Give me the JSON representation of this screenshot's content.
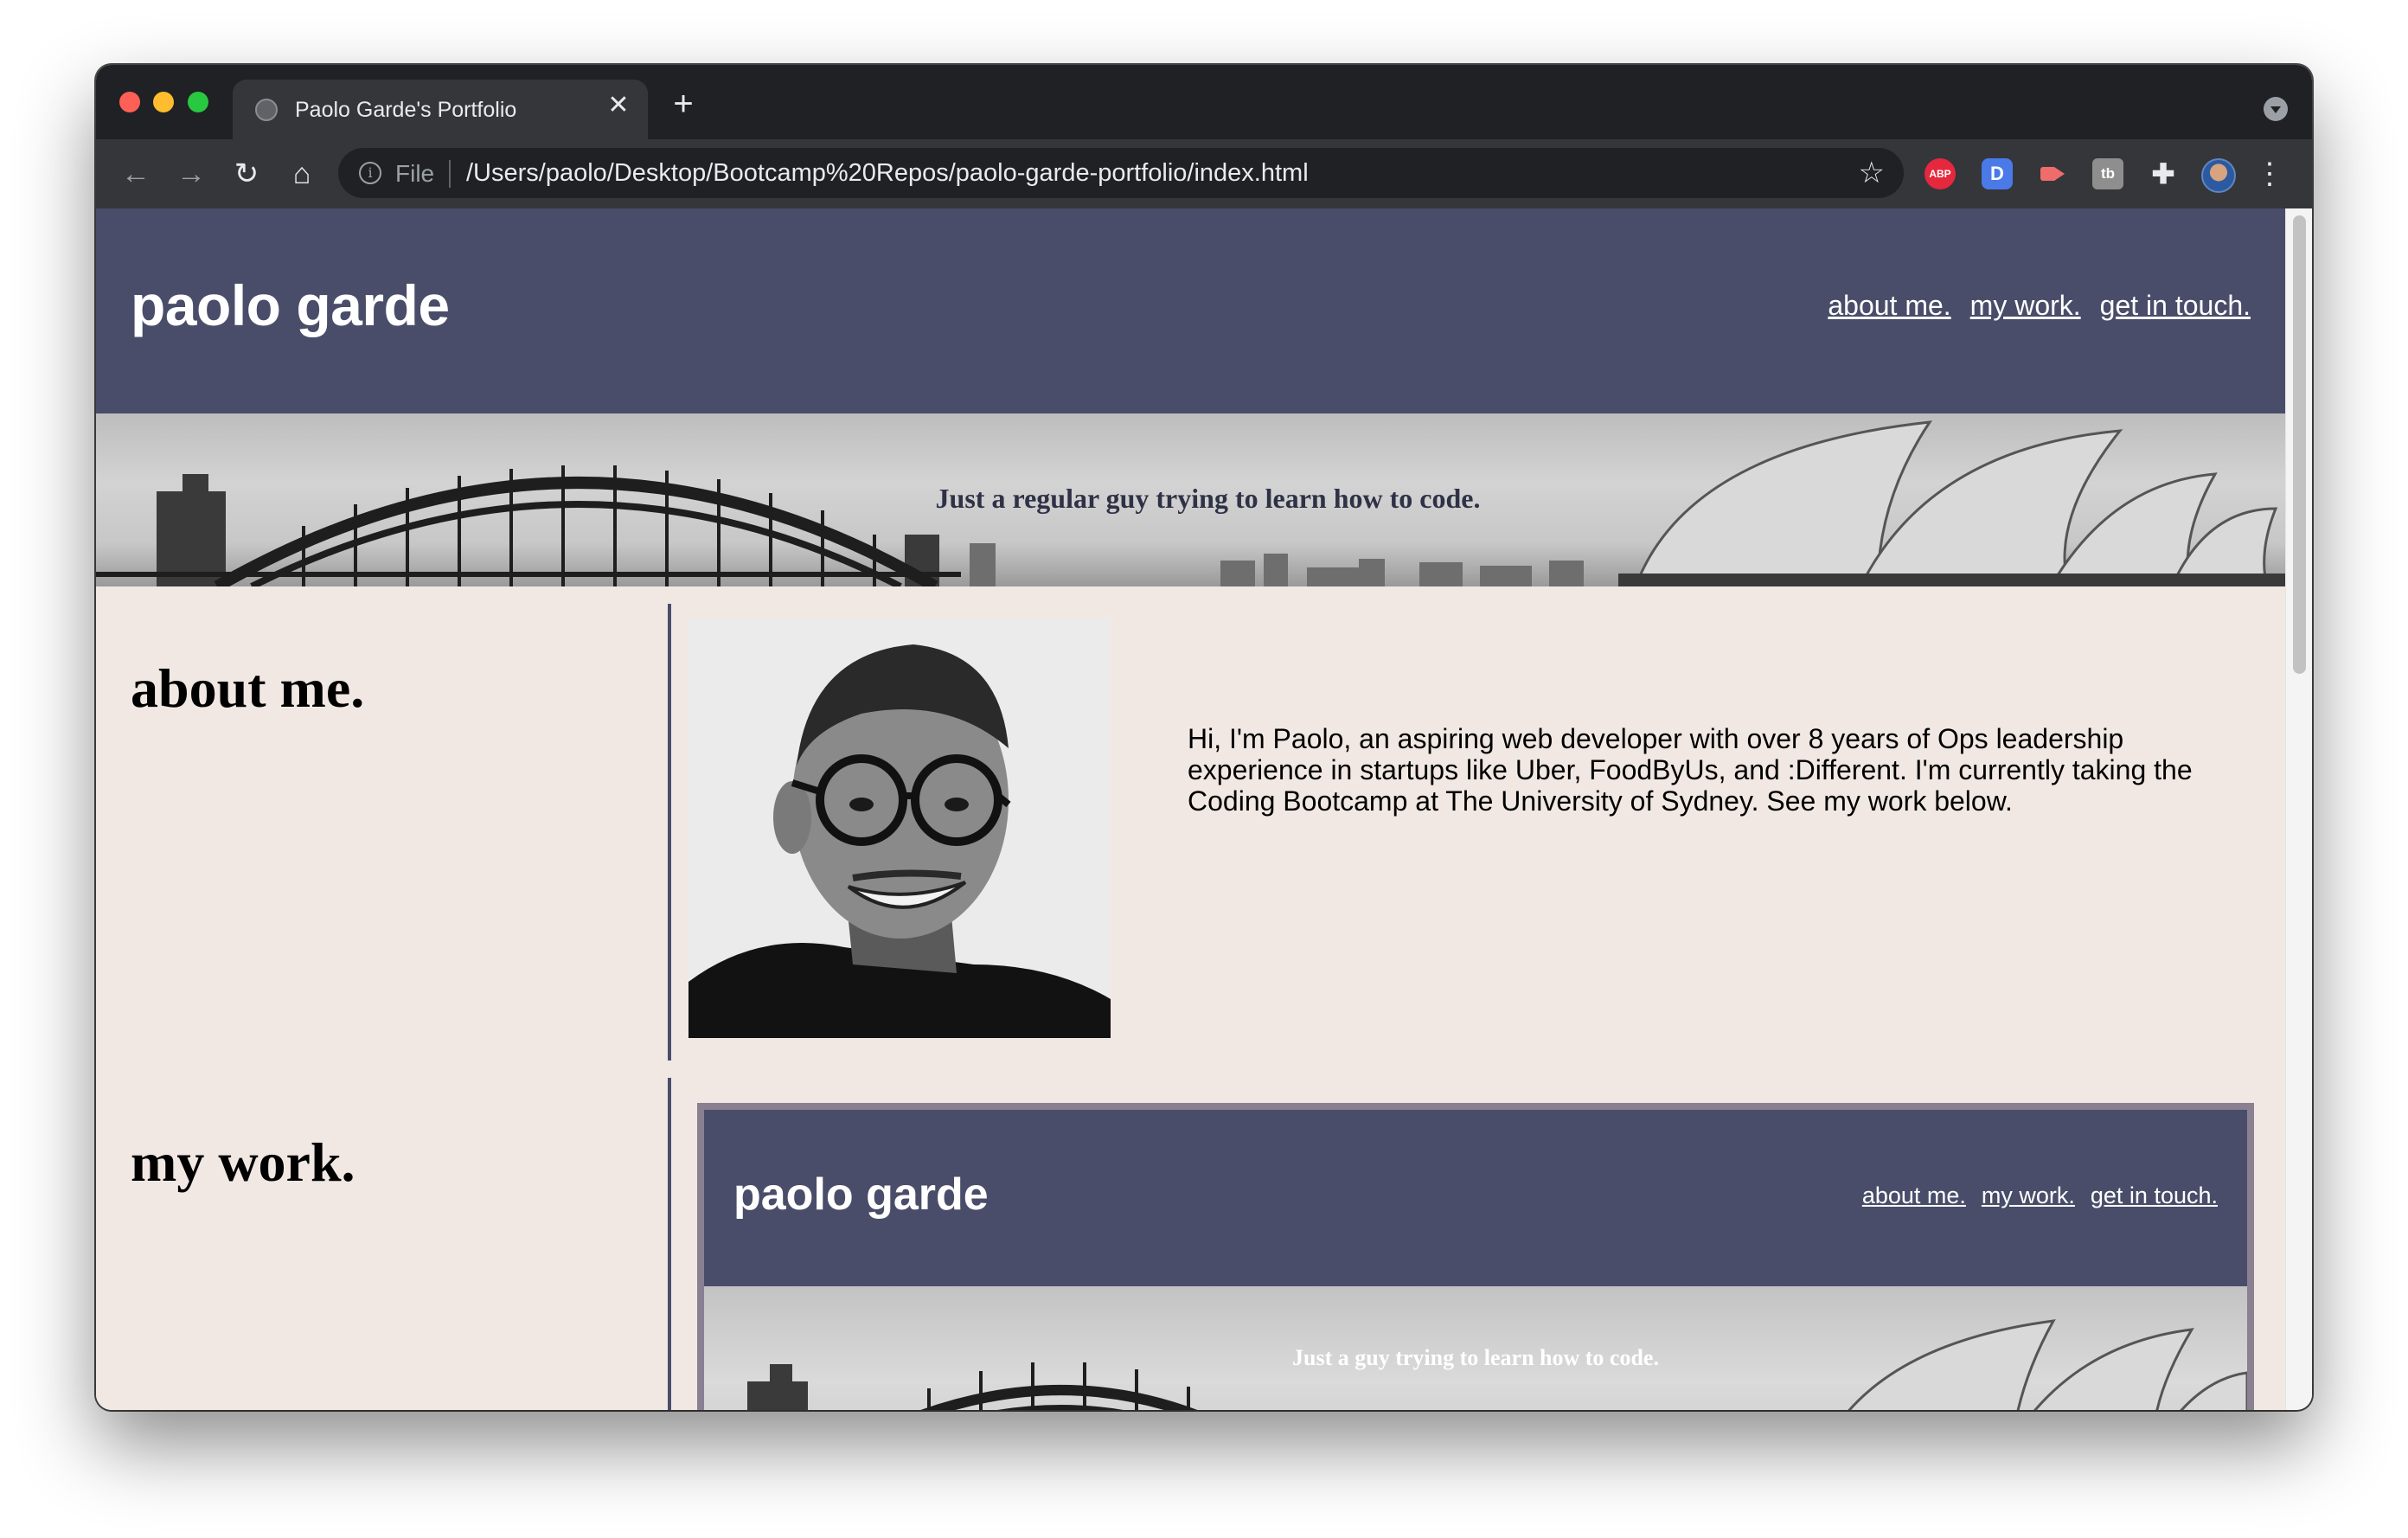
{
  "browser": {
    "tab_title": "Paolo Garde's Portfolio",
    "tab_close": "✕",
    "new_tab": "+",
    "url_scheme_label": "File",
    "url": "/Users/paolo/Desktop/Bootcamp%20Repos/paolo-garde-portfolio/index.html",
    "extensions": [
      {
        "name": "adblock-plus",
        "label": "ABP"
      },
      {
        "name": "d-extension",
        "label": "D"
      },
      {
        "name": "tb-extension",
        "label": "tb"
      }
    ]
  },
  "site": {
    "brand": "paolo garde",
    "nav": [
      "about me.",
      "my work.",
      "get in touch."
    ],
    "tagline": "Just a regular guy trying to learn how to code.",
    "about_heading": "about me.",
    "bio": "Hi, I'm Paolo, an aspiring web developer with over 8 years of Ops leadership experience in startups like Uber, FoodByUs, and :Different. I'm currently taking the Coding Bootcamp at The University of Sydney. See my work below.",
    "work_heading": "my work."
  },
  "preview": {
    "brand": "paolo garde",
    "nav": [
      "about me.",
      "my work.",
      "get in touch."
    ],
    "tagline": "Just a guy trying to learn how to code."
  },
  "colors": {
    "header_bg": "#494d69",
    "page_bg": "#f1e8e3",
    "chrome_dark": "#202124",
    "chrome_toolbar": "#35363a"
  }
}
